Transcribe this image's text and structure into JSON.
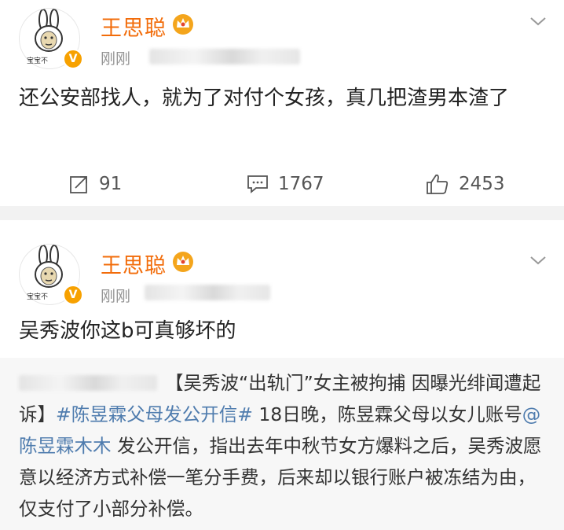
{
  "posts": [
    {
      "username": "王思聪",
      "avatar_caption": "宝宝不",
      "time": "刚刚",
      "text": "还公安部找人，就为了对付个女孩，真几把渣男本渣了",
      "actions": {
        "repost_count": "91",
        "comment_count": "1767",
        "like_count": "2453"
      }
    },
    {
      "username": "王思聪",
      "avatar_caption": "宝宝不",
      "time": "刚刚",
      "text": "吴秀波你这b可真够坏的",
      "repost": {
        "title": "【吴秀波“出轨门”女主被拘捕 因曝光绯闻遭起诉】",
        "hashtag": "#陈昱霖父母发公开信#",
        "body_1": " 18日晚，陈昱霖父母以女儿账号",
        "mention": "@陈昱霖木木",
        "body_2": " 发公开信，指出去年中秋节女方爆料之后，吴秀波愿意以经济方式补偿一笔分手费，后来却以银行账户被冻结为由，仅支付了小部分补偿。"
      }
    }
  ],
  "icons": {
    "verified": "verified-badge-icon",
    "crown": "crown-icon",
    "menu": "chevron-down-icon",
    "repost": "repost-icon",
    "comment": "comment-icon",
    "like": "thumbs-up-icon"
  },
  "colors": {
    "username": "#f26c0a",
    "link": "#4f7cae",
    "badge": "#f7a100",
    "crown": "#f4a51c"
  }
}
